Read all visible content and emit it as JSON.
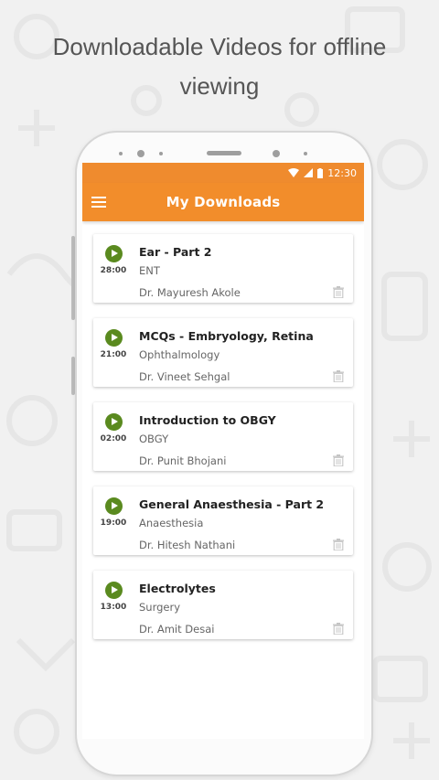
{
  "headline": {
    "line1": "Downloadable Videos for offline",
    "line2": "viewing"
  },
  "status_bar": {
    "time": "12:30"
  },
  "app_bar": {
    "title": "My Downloads",
    "menu_icon": "hamburger-icon"
  },
  "downloads": [
    {
      "title": "Ear - Part 2",
      "duration": "28:00",
      "subject": "ENT",
      "author": "Dr. Mayuresh Akole"
    },
    {
      "title": "MCQs - Embryology, Retina",
      "duration": "21:00",
      "subject": "Ophthalmology",
      "author": "Dr. Vineet Sehgal"
    },
    {
      "title": "Introduction to OBGY",
      "duration": "02:00",
      "subject": "OBGY",
      "author": "Dr. Punit Bhojani"
    },
    {
      "title": "General Anaesthesia - Part 2",
      "duration": "19:00",
      "subject": "Anaesthesia",
      "author": "Dr. Hitesh Nathani"
    },
    {
      "title": "Electrolytes",
      "duration": "13:00",
      "subject": "Surgery",
      "author": "Dr. Amit Desai"
    }
  ],
  "colors": {
    "accent": "#f28d2b",
    "play": "#5a8a1f",
    "background": "#f1f1f1"
  }
}
